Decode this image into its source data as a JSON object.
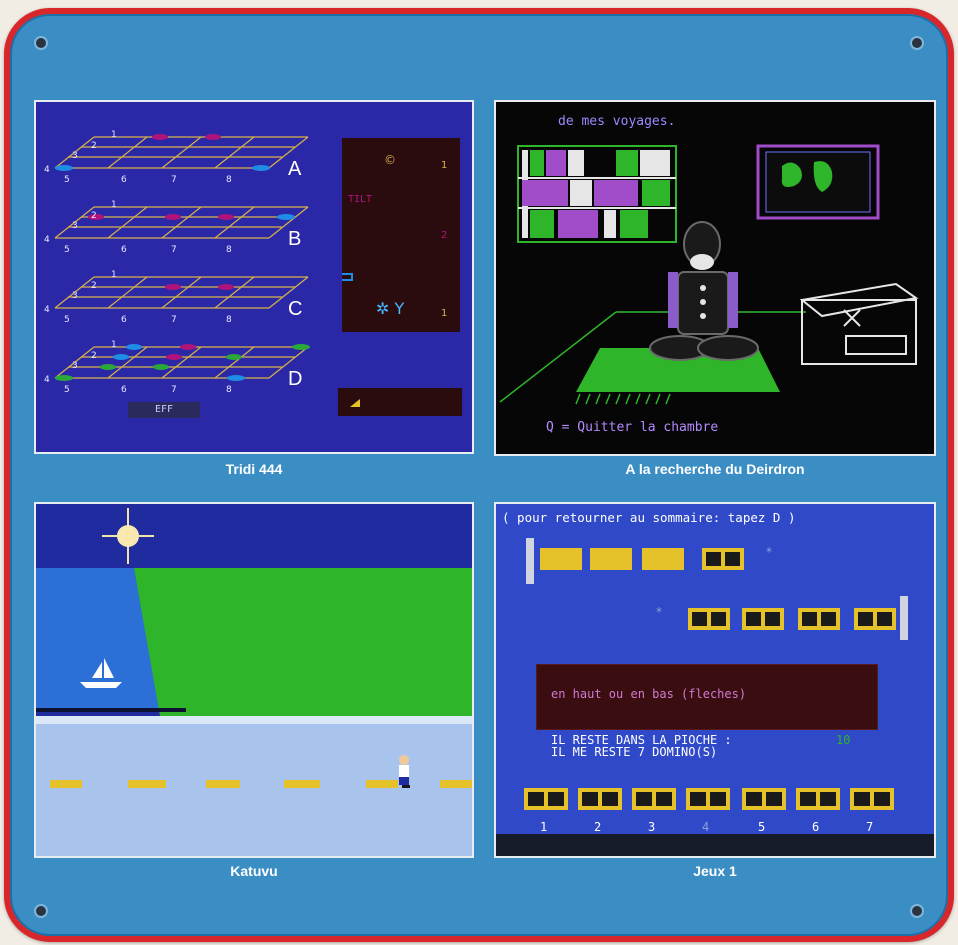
{
  "panels": {
    "tridi": {
      "caption": "Tridi 444",
      "row_labels": [
        "A",
        "B",
        "C",
        "D"
      ],
      "eff_label": "EFF",
      "sidebar_label": "TILT"
    },
    "deirdron": {
      "caption": "A la recherche du Deirdron",
      "title_text": "de mes voyages.",
      "quit_text": "Q = Quitter la chambre"
    },
    "katuvu": {
      "caption": "Katuvu"
    },
    "jeux": {
      "caption": "Jeux 1",
      "top_text": "( pour retourner au sommaire: tapez D )",
      "message": "en haut ou en bas (fleches)",
      "info_line1": "IL RESTE DANS LA PIOCHE :",
      "info_line1_value": "10",
      "info_line2": "IL ME RESTE  7  DOMINO(S)",
      "numbers": [
        "1",
        "2",
        "3",
        "4",
        "5",
        "6",
        "7"
      ]
    }
  },
  "colors": {
    "board": "#3b8ec4",
    "border": "#d8262a",
    "tridi_bg": "#2b28a8",
    "deirdron_bg": "#060606",
    "katuvu_sky": "#1f2b9e",
    "katuvu_grass": "#2fb52a",
    "jeux_bg": "#2f49c9"
  }
}
